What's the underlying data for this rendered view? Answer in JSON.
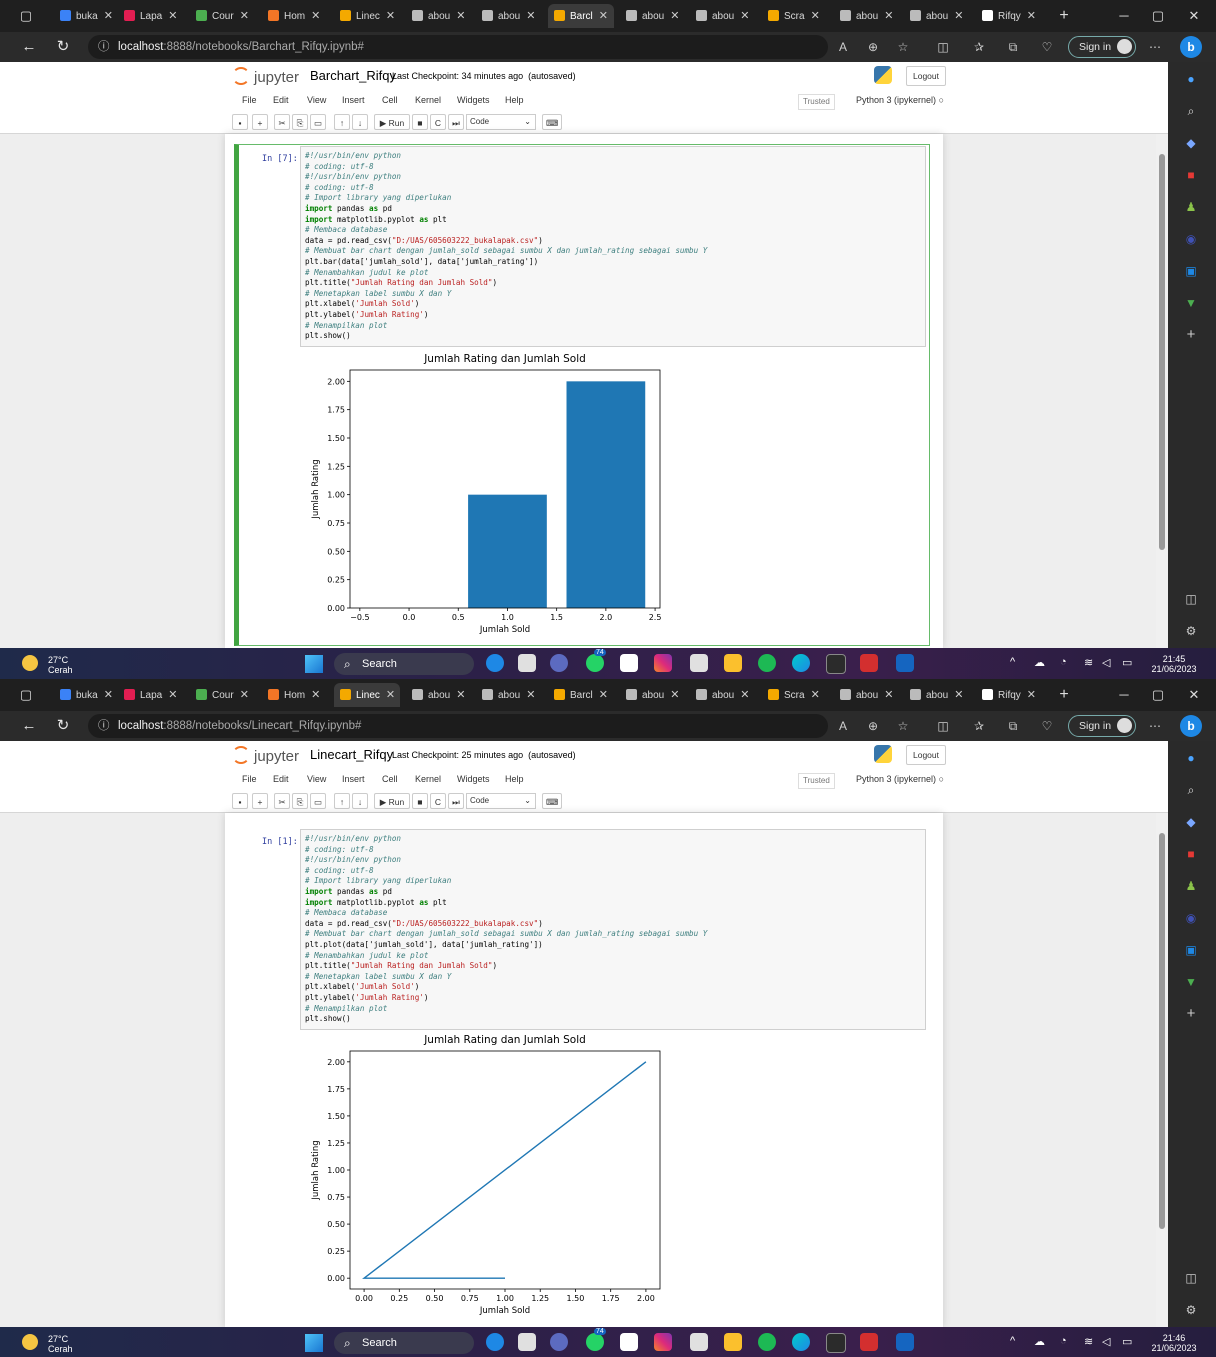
{
  "browser": {
    "tabs": [
      {
        "label": "buka",
        "icon": "search-icon",
        "color": "#3b82f6"
      },
      {
        "label": "Lapa",
        "icon": "bukalapak-icon",
        "color": "#e31e52"
      },
      {
        "label": "Cour",
        "icon": "course-icon",
        "color": "#4caf50"
      },
      {
        "label": "Hom",
        "icon": "jupyter-icon",
        "color": "#f37626"
      },
      {
        "label": "Linec",
        "icon": "notebook-icon",
        "color": "#f4a900"
      },
      {
        "label": "abou",
        "icon": "page-icon",
        "color": "#bbbbbb"
      },
      {
        "label": "abou",
        "icon": "page-icon",
        "color": "#bbbbbb"
      },
      {
        "label": "Barcl",
        "icon": "notebook-icon",
        "color": "#f4a900"
      },
      {
        "label": "abou",
        "icon": "page-icon",
        "color": "#bbbbbb"
      },
      {
        "label": "abou",
        "icon": "page-icon",
        "color": "#bbbbbb"
      },
      {
        "label": "Scra",
        "icon": "notebook-icon",
        "color": "#f4a900"
      },
      {
        "label": "abou",
        "icon": "page-icon",
        "color": "#bbbbbb"
      },
      {
        "label": "abou",
        "icon": "page-icon",
        "color": "#bbbbbb"
      },
      {
        "label": "Rifqy",
        "icon": "github-icon",
        "color": "#ffffff"
      }
    ],
    "sign_in": "Sign in",
    "new_tab": "+"
  },
  "jupyter": {
    "logo_text": "jupyter",
    "menu": [
      "File",
      "Edit",
      "View",
      "Insert",
      "Cell",
      "Kernel",
      "Widgets",
      "Help"
    ],
    "trusted": "Trusted",
    "kernel": "Python 3 (ipykernel)",
    "logout": "Logout",
    "run_label": "Run",
    "cell_type": "Code"
  },
  "taskbar": {
    "temp": "27°C",
    "condition": "Cerah",
    "search": "Search",
    "date": "21/06/2023",
    "badge": "74"
  },
  "screens": [
    {
      "active_tab": 7,
      "url_host": "localhost",
      "url_rest": ":8888/notebooks/Barchart_Rifqy.ipynb#",
      "notebook_name": "Barchart_Rifqy",
      "checkpoint": "Last Checkpoint: 34 minutes ago",
      "autosaved": "(autosaved)",
      "prompt": "In [7]:",
      "plot_call": "plt.bar(data['jumlah_sold'], data['jumlah_rating'])",
      "time": "21:45",
      "selected": true
    },
    {
      "active_tab": 4,
      "url_host": "localhost",
      "url_rest": ":8888/notebooks/Linecart_Rifqy.ipynb#",
      "notebook_name": "Linecart_Rifqy",
      "checkpoint": "Last Checkpoint: 25 minutes ago",
      "autosaved": "(autosaved)",
      "prompt": "In [1]:",
      "plot_call": "plt.plot(data['jumlah_sold'], data['jumlah_rating'])",
      "time": "21:46",
      "selected": false
    }
  ],
  "code": {
    "l1": "#!/usr/bin/env python",
    "l2": "# coding: utf-8",
    "l3": "#!/usr/bin/env python",
    "l4": "# coding: utf-8",
    "l5": "# Import library yang diperlukan",
    "l6a": "import",
    "l6b": " pandas ",
    "l6c": "as",
    "l6d": " pd",
    "l7a": "import",
    "l7b": " matplotlib.pyplot ",
    "l7c": "as",
    "l7d": " plt",
    "l8": "# Membaca database",
    "l9a": "data = pd.read_csv(",
    "l9b": "\"D:/UAS/605603222_bukalapak.csv\"",
    "l9c": ")",
    "l10": "# Membuat bar chart dengan jumlah_sold sebagai sumbu X dan jumlah_rating sebagai sumbu Y",
    "l12": "# Menambahkan judul ke plot",
    "l13a": "plt.title(",
    "l13b": "\"Jumlah Rating dan Jumlah Sold\"",
    "l13c": ")",
    "l14": "# Menetapkan label sumbu X dan Y",
    "l15a": "plt.xlabel(",
    "l15b": "'Jumlah Sold'",
    "l15c": ")",
    "l16a": "plt.ylabel(",
    "l16b": "'Jumlah Rating'",
    "l16c": ")",
    "l17": "# Menampilkan plot",
    "l18": "plt.show()"
  },
  "chart_data": [
    {
      "type": "bar",
      "title": "Jumlah Rating dan Jumlah Sold",
      "xlabel": "Jumlah Sold",
      "ylabel": "Jumlah Rating",
      "x": [
        1,
        2
      ],
      "values": [
        1,
        2
      ],
      "bar_width": 0.8,
      "xlim": [
        -0.6,
        2.55
      ],
      "ylim": [
        0,
        2.1
      ],
      "xticks": [
        "−0.5",
        "0.0",
        "0.5",
        "1.0",
        "1.5",
        "2.0",
        "2.5"
      ],
      "xtick_values": [
        -0.5,
        0,
        0.5,
        1,
        1.5,
        2,
        2.5
      ],
      "yticks": [
        "0.00",
        "0.25",
        "0.50",
        "0.75",
        "1.00",
        "1.25",
        "1.50",
        "1.75",
        "2.00"
      ],
      "ytick_values": [
        0,
        0.25,
        0.5,
        0.75,
        1,
        1.25,
        1.5,
        1.75,
        2
      ],
      "color": "#1f77b4",
      "grid": false
    },
    {
      "type": "line",
      "title": "Jumlah Rating dan Jumlah Sold",
      "xlabel": "Jumlah Sold",
      "ylabel": "Jumlah Rating",
      "x": [
        1,
        0,
        2
      ],
      "y": [
        0,
        0,
        2
      ],
      "xlim": [
        -0.1,
        2.1
      ],
      "ylim": [
        -0.1,
        2.1
      ],
      "xticks": [
        "0.00",
        "0.25",
        "0.50",
        "0.75",
        "1.00",
        "1.25",
        "1.50",
        "1.75",
        "2.00"
      ],
      "xtick_values": [
        0,
        0.25,
        0.5,
        0.75,
        1,
        1.25,
        1.5,
        1.75,
        2
      ],
      "yticks": [
        "0.00",
        "0.25",
        "0.50",
        "0.75",
        "1.00",
        "1.25",
        "1.50",
        "1.75",
        "2.00"
      ],
      "ytick_values": [
        0,
        0.25,
        0.5,
        0.75,
        1,
        1.25,
        1.5,
        1.75,
        2
      ],
      "color": "#1f77b4",
      "grid": false
    }
  ]
}
